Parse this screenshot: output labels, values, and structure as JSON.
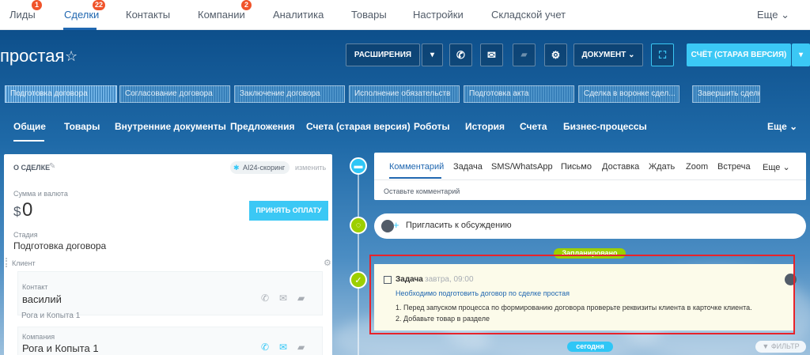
{
  "topnav": {
    "items": [
      {
        "label": "Лиды",
        "badge": "1"
      },
      {
        "label": "Сделки",
        "badge": "22",
        "active": true
      },
      {
        "label": "Контакты"
      },
      {
        "label": "Компании",
        "badge": "2"
      },
      {
        "label": "Аналитика"
      },
      {
        "label": "Товары"
      },
      {
        "label": "Настройки"
      },
      {
        "label": "Складской учет"
      }
    ],
    "more": "Еще ⌄"
  },
  "header": {
    "title": "простая",
    "star": "☆",
    "extensions": "РАСШИРЕНИЯ",
    "extensions_caret": "▾",
    "phone_icon": "✆",
    "mail_icon": "✉",
    "chat_icon": "▰",
    "settings_icon": "⚙",
    "document": "ДОКУМЕНТ ⌄",
    "fullscreen_icon": "⛶",
    "invoice": "СЧЁТ (СТАРАЯ ВЕРСИЯ)",
    "invoice_caret": "▾"
  },
  "stages": [
    "Подготовка договора",
    "Согласование договора",
    "Заключение договора",
    "Исполнение обязательств",
    "Подготовка акта",
    "Сделка в воронке сдел...",
    "Завершить сделку"
  ],
  "sections": {
    "items": [
      "Общие",
      "Товары",
      "Внутренние документы",
      "Предложения",
      "Счета (старая версия)",
      "Роботы",
      "История",
      "Счета",
      "Бизнес-процессы"
    ],
    "more": "Еще ⌄"
  },
  "deal": {
    "header": "О СДЕЛКЕ",
    "edit_icon": "✎",
    "scoring": "AI24-скоринг",
    "change": "изменить",
    "amount_label": "Сумма и валюта",
    "currency": "$",
    "amount": "0",
    "pay_button": "ПРИНЯТЬ ОПЛАТУ",
    "stage_label": "Стадия",
    "stage_value": "Подготовка договора",
    "client_label": "Клиент",
    "gear_icon": "⚙",
    "contact_label": "Контакт",
    "contact_name": "василий",
    "contact_company": "Рога и Копыта 1",
    "company_label": "Компания",
    "company_name": "Рога и Копыта 1",
    "phone_icon": "✆",
    "mail_icon": "✉",
    "chat_icon": "▰"
  },
  "timeline": {
    "tabs": [
      "Комментарий",
      "Задача",
      "SMS/WhatsApp",
      "Письмо",
      "Доставка",
      "Ждать",
      "Zoom",
      "Встреча"
    ],
    "more": "Еще ⌄",
    "comment_placeholder": "Оставьте комментарий",
    "invite": "Пригласить к обсуждению",
    "planned": "Запланировано",
    "task_title": "Задача",
    "task_time": "завтра, 09:00",
    "task_link": "Необходимо подготовить договор по сделке простая",
    "task_step1": "1. Перед запуском процесса по формированию договора проверьте реквизиты клиента в карточке клиента.",
    "task_step2": "2. Добавьте товар в разделе",
    "today": "сегодня",
    "filter": "ФИЛЬТР"
  },
  "colors": {
    "accent": "#2067b0",
    "badge": "#f0542b",
    "primary_button": "#3bc8f5",
    "timeline_green": "#9dcf00",
    "highlight_border": "#e7232b"
  }
}
